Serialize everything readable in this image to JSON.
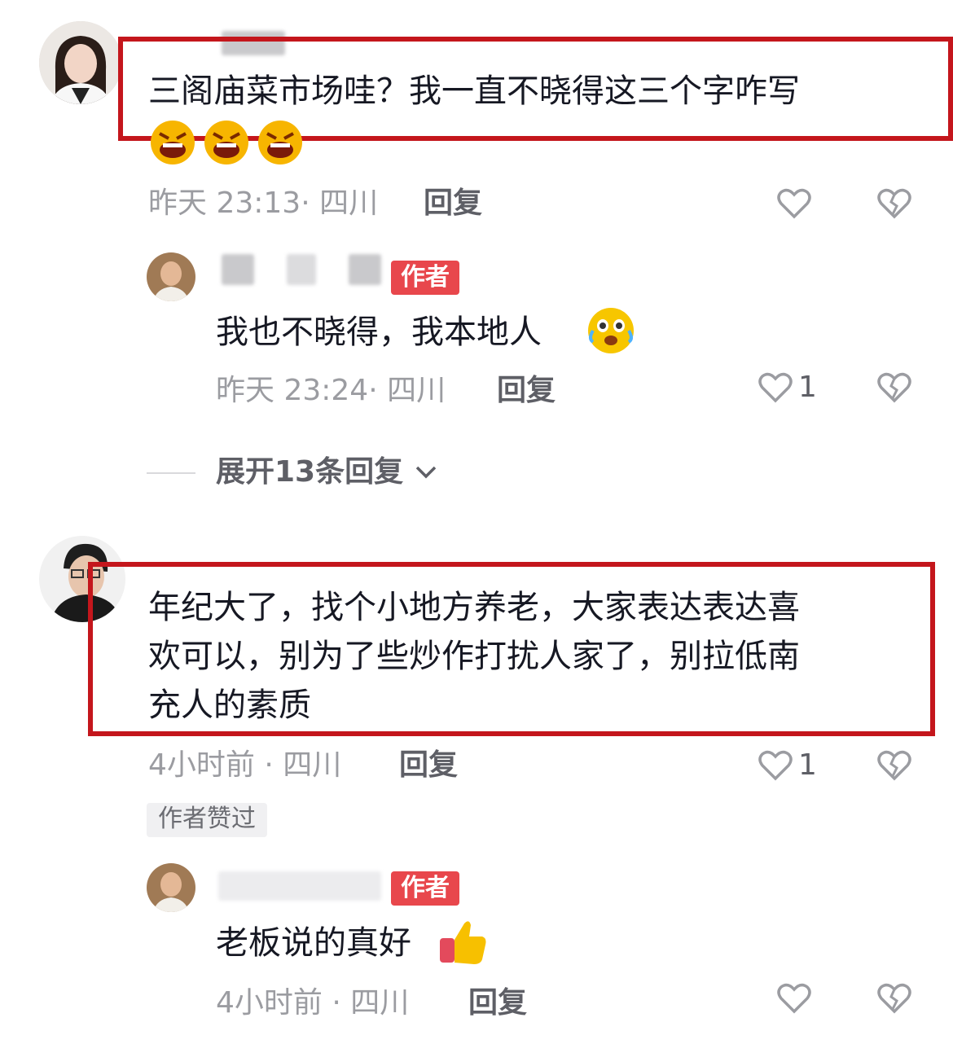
{
  "comments": [
    {
      "text": "三阁庙菜市场哇？我一直不晓得这三个字咋写",
      "time": "昨天 23:13",
      "location": "四川",
      "reply_label": "回复",
      "emoji": "angry-face-emoji"
    },
    {
      "text": "我也不晓得，我本地人",
      "time": "昨天 23:24",
      "location": "四川",
      "reply_label": "回复",
      "author_badge": "作者",
      "like_count": "1",
      "emoji": "crying-laughing-emoji"
    },
    {
      "expand_label": "展开13条回复"
    },
    {
      "text_lines": [
        "年纪大了，找个小地方养老，大家表达表达喜",
        "欢可以，别为了些炒作打扰人家了，别拉低南",
        "充人的素质"
      ],
      "time": "4小时前",
      "location": "四川",
      "reply_label": "回复",
      "like_count": "1",
      "author_liked_label": "作者赞过"
    },
    {
      "text": "老板说的真好",
      "time": "4小时前",
      "location": "四川",
      "reply_label": "回复",
      "author_badge": "作者",
      "emoji": "thumbs-up-emoji"
    }
  ],
  "colors": {
    "highlight_box": "#c4161c",
    "author_badge": "#e8474c",
    "meta_text": "#9b9ca1"
  }
}
